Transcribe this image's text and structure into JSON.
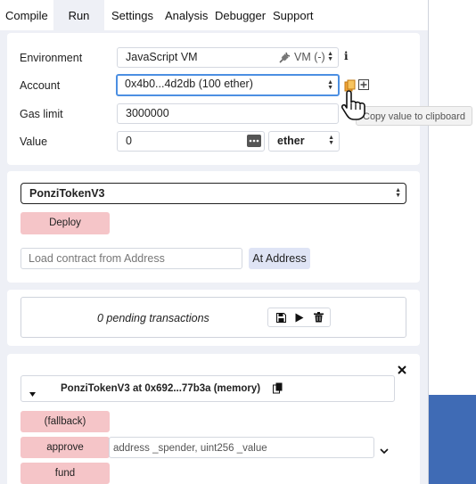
{
  "tabs": {
    "compile": "Compile",
    "run": "Run",
    "settings": "Settings",
    "analysis": "Analysis",
    "debugger": "Debugger",
    "support": "Support"
  },
  "run": {
    "environment_label": "Environment",
    "environment_value": "JavaScript VM",
    "environment_vm": "VM (-)",
    "info_icon_text": "i",
    "account_label": "Account",
    "account_value": "0x4b0...4d2db (100 ether)",
    "copy_tooltip": "Copy value to clipboard",
    "gas_limit_label": "Gas limit",
    "gas_limit_value": "3000000",
    "value_label": "Value",
    "value_value": "0",
    "value_unit": "ether"
  },
  "contract": {
    "selected": "PonziTokenV3",
    "deploy_label": "Deploy",
    "load_placeholder": "Load contract from Address",
    "at_address_label": "At Address"
  },
  "pending": {
    "text": "0 pending transactions"
  },
  "instance": {
    "title": "PonziTokenV3 at 0x692...77b3a (memory)",
    "fallback_label": "(fallback)",
    "approve_label": "approve",
    "approve_placeholder": "address _spender, uint256 _value",
    "fund_label": "fund"
  },
  "colors": {
    "accent": "#4c8fe2",
    "button_red": "#f5c5c8",
    "button_blue": "#dfe4f5",
    "panel_bg": "#eef0f6"
  },
  "icons": [
    "plug-icon",
    "info-icon",
    "copy-icon",
    "plus-square-icon",
    "hand-cursor-icon",
    "dots-icon",
    "save-icon",
    "play-icon",
    "trash-icon",
    "close-icon",
    "caret-down-icon",
    "chevron-down-icon"
  ]
}
